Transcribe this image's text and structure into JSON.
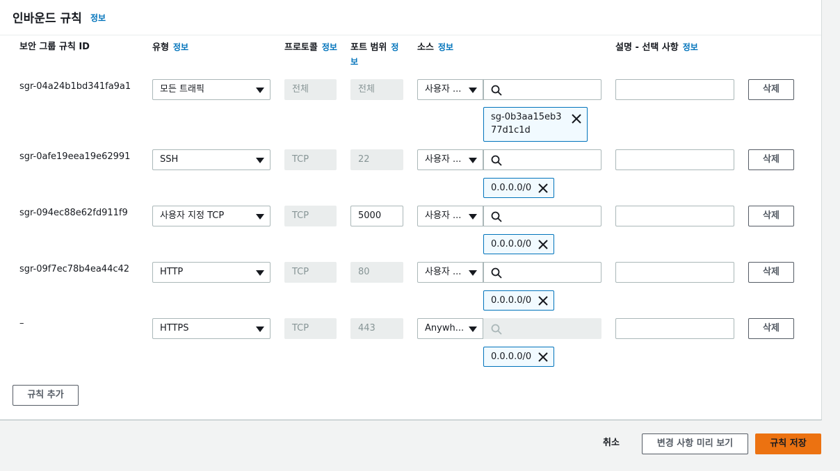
{
  "header": {
    "title": "인바운드 규칙",
    "info": "정보"
  },
  "columns": {
    "rule_id": "보안 그룹 규칙 ID",
    "type": "유형",
    "protocol": "프로토콜",
    "port": "포트 범위",
    "source": "소스",
    "description": "설명 - 선택 사항",
    "info": "정보"
  },
  "rules": [
    {
      "id": "sgr-04a24b1bd341fa9a1",
      "type": "모든 트래픽",
      "protocol": "전체",
      "port": "전체",
      "source": "사용자 ...",
      "token_line1": "sg-0b3aa15eb3",
      "token_line2": "77d1c1d"
    },
    {
      "id": "sgr-0afe19eea19e62991",
      "type": "SSH",
      "protocol": "TCP",
      "port": "22",
      "source": "사용자 ...",
      "token": "0.0.0.0/0"
    },
    {
      "id": "sgr-094ec88e62fd911f9",
      "type": "사용자 지정 TCP",
      "protocol": "TCP",
      "port": "5000",
      "source": "사용자 ...",
      "token": "0.0.0.0/0"
    },
    {
      "id": "sgr-09f7ec78b4ea44c42",
      "type": "HTTP",
      "protocol": "TCP",
      "port": "80",
      "source": "사용자 ...",
      "token": "0.0.0.0/0"
    },
    {
      "id": "–",
      "type": "HTTPS",
      "protocol": "TCP",
      "port": "443",
      "source": "Anywh...",
      "token": "0.0.0.0/0"
    }
  ],
  "delete_label": "삭제",
  "add_rule": "규칙 추가",
  "footer": {
    "cancel": "취소",
    "preview": "변경 사항 미리 보기",
    "save": "규칙 저장"
  },
  "colors": {
    "link": "#0073bb",
    "primary": "#ff9900",
    "token_bg": "#f1faff"
  },
  "icons": {
    "search": "search-icon",
    "remove": "close-icon",
    "dropdown": "caret-down-icon"
  }
}
